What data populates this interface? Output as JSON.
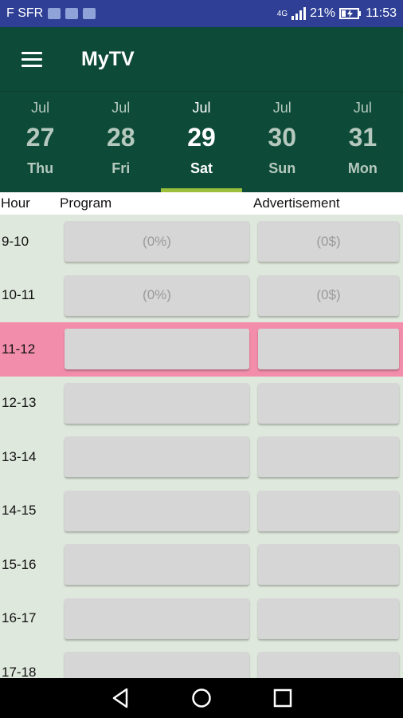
{
  "status": {
    "carrier": "F SFR",
    "network": "4G",
    "battery": "21%",
    "time": "11:53"
  },
  "app": {
    "title": "MyTV"
  },
  "days": [
    {
      "month": "Jul",
      "date": "27",
      "weekday": "Thu"
    },
    {
      "month": "Jul",
      "date": "28",
      "weekday": "Fri"
    },
    {
      "month": "Jul",
      "date": "29",
      "weekday": "Sat"
    },
    {
      "month": "Jul",
      "date": "30",
      "weekday": "Sun"
    },
    {
      "month": "Jul",
      "date": "31",
      "weekday": "Mon"
    }
  ],
  "selected_day_index": 2,
  "table": {
    "headers": {
      "hour": "Hour",
      "program": "Program",
      "advertisement": "Advertisement"
    },
    "rows": [
      {
        "hour": "9-10",
        "program": "(0%)",
        "advertisement": "(0$)"
      },
      {
        "hour": "10-11",
        "program": "(0%)",
        "advertisement": "(0$)"
      },
      {
        "hour": "11-12",
        "program": "",
        "advertisement": ""
      },
      {
        "hour": "12-13",
        "program": "",
        "advertisement": ""
      },
      {
        "hour": "13-14",
        "program": "",
        "advertisement": ""
      },
      {
        "hour": "14-15",
        "program": "",
        "advertisement": ""
      },
      {
        "hour": "15-16",
        "program": "",
        "advertisement": ""
      },
      {
        "hour": "16-17",
        "program": "",
        "advertisement": ""
      },
      {
        "hour": "17-18",
        "program": "",
        "advertisement": ""
      }
    ],
    "highlighted_row_index": 2
  },
  "colors": {
    "appbar": "#0d4a37",
    "statusbar": "#2e3f95",
    "highlight": "#f28eab",
    "tab_indicator": "#9bbf3a"
  },
  "icons": {
    "menu": "menu-icon",
    "back": "back-icon",
    "home": "home-icon",
    "recents": "recents-icon"
  }
}
